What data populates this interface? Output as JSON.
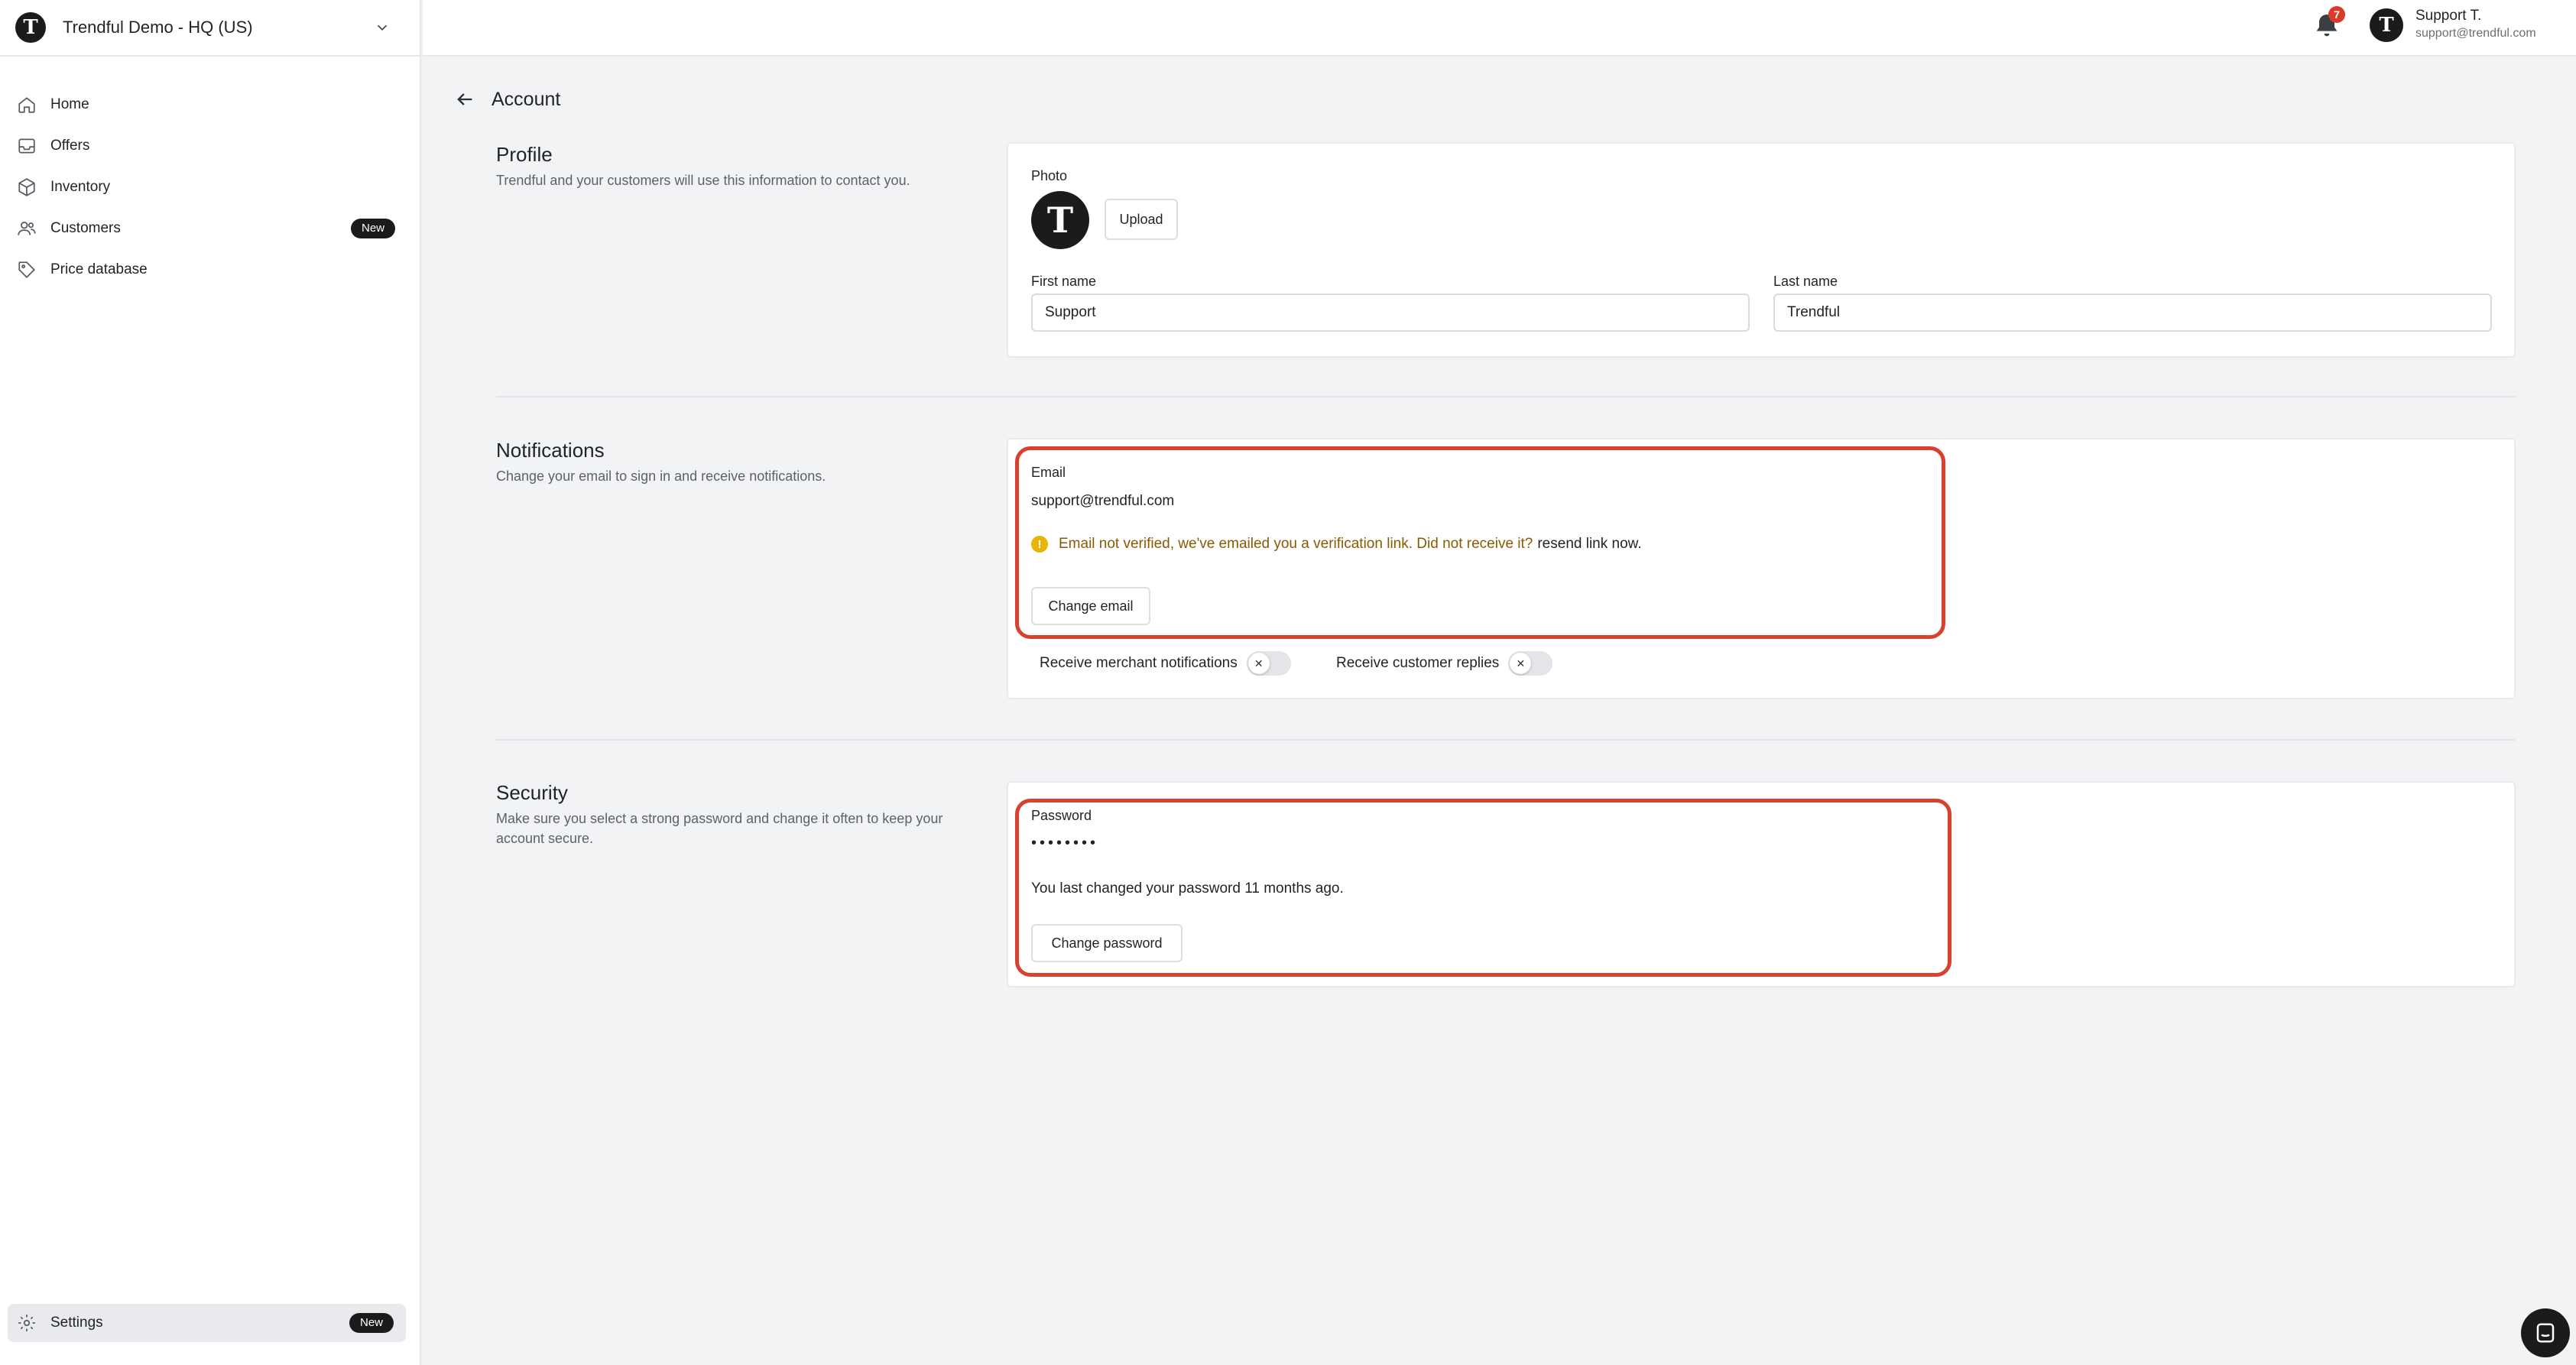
{
  "workspace": {
    "name": "Trendful Demo - HQ (US)",
    "logo_letter": "T"
  },
  "sidebar": {
    "items": [
      {
        "label": "Home",
        "icon": "home-icon"
      },
      {
        "label": "Offers",
        "icon": "inbox-icon"
      },
      {
        "label": "Inventory",
        "icon": "box-icon"
      },
      {
        "label": "Customers",
        "icon": "users-icon",
        "badge": "New"
      },
      {
        "label": "Price database",
        "icon": "tag-icon"
      }
    ],
    "settings": {
      "label": "Settings",
      "icon": "gear-icon",
      "badge": "New"
    }
  },
  "topbar": {
    "notification_count": "7",
    "user": {
      "initial": "T",
      "name": "Support T.",
      "email": "support@trendful.com"
    }
  },
  "page": {
    "title": "Account"
  },
  "profile": {
    "title": "Profile",
    "description": "Trendful and your customers will use this information to contact you.",
    "photo_label": "Photo",
    "photo_initial": "T",
    "upload_label": "Upload",
    "first_name_label": "First name",
    "first_name_value": "Support",
    "last_name_label": "Last name",
    "last_name_value": "Trendful"
  },
  "notifications": {
    "title": "Notifications",
    "description": "Change your email to sign in and receive notifications.",
    "email_label": "Email",
    "email_value": "support@trendful.com",
    "warning_text": "Email not verified, we've emailed you a verification link. Did not receive it?",
    "resend_link": "resend link now.",
    "change_email_label": "Change email",
    "merchant_toggle_label": "Receive merchant notifications",
    "customer_toggle_label": "Receive customer replies",
    "merchant_toggle_on": false,
    "customer_toggle_on": false
  },
  "security": {
    "title": "Security",
    "description": "Make sure you select a strong password and change it often to keep your account secure.",
    "password_label": "Password",
    "password_mask": "••••••••",
    "last_changed": "You last changed your password 11 months ago.",
    "change_password_label": "Change password"
  },
  "colors": {
    "highlight": "#d9412f",
    "warning_icon": "#eab308",
    "warning_text": "#8a5a00",
    "badge_bg": "#1b1b1b",
    "notification_badge": "#d93b2b"
  }
}
